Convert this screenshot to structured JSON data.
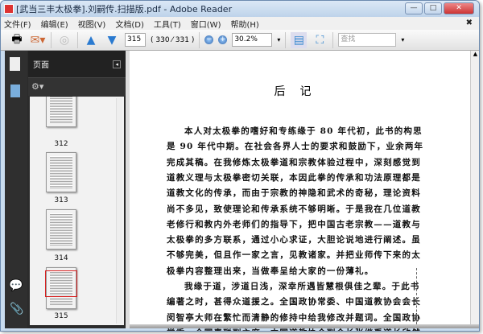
{
  "window": {
    "title": "[武当三丰太极拳].刘嗣传.扫描版.pdf - Adobe Reader",
    "minimize": "—",
    "maximize": "□",
    "close": "✕"
  },
  "menu": [
    "文件(F)",
    "编辑(E)",
    "视图(V)",
    "文档(D)",
    "工具(T)",
    "窗口(W)",
    "帮助(H)"
  ],
  "menu_close": "✖",
  "toolbar": {
    "page_input": "315",
    "page_count": "( 330 ⁄ 331 )",
    "zoom": "30.2%",
    "find_placeholder": "查找"
  },
  "sidebar": {
    "panel_title": "页面",
    "thumbnails": [
      "312",
      "313",
      "314",
      "315"
    ],
    "current_page": "315",
    "accent": "#d62020"
  },
  "document": {
    "heading": "后记",
    "lines": [
      "本人对太极拳的嗜好和专练缘于 80 年代初，此书的构思",
      "是 90 年代中期。在社会各界人士的要求和鼓励下，业余两年",
      "完成其稿。在我修炼太极拳道和宗教体验过程中，深刻感觉到",
      "道教义理与太极拳密切关联，本因此拳的传承和功法原理都是",
      "道教文化的传承，而由于宗教的神隐和武术的奇秘，理论资料",
      "尚不多见，致使理论和传承系统不够明晰。于是我在几位道教",
      "老修行和教内外老师们的指导下，把中国古老宗教——道教与",
      "太极拳的多方联系，通过小心求证，大胆论说地进行阐述。虽",
      "不够完美，但且作一家之言，见教诸家。并把业师传下来的太",
      "极拳内容整理出来，当做奉呈给大家的一份薄礼。",
      "我缘于道，涉道日浅，深幸所遇皆慧根俱佳之辈。于此书",
      "编著之时，甚得众道援之。全国政协常委、中国道教协会会长",
      "闵智亭大师在繁忙而清静的修持中给我修改并题词。全国政协",
      "常委、全国青联副主席、中国道教协会副会长张继禹道长欣然"
    ]
  }
}
